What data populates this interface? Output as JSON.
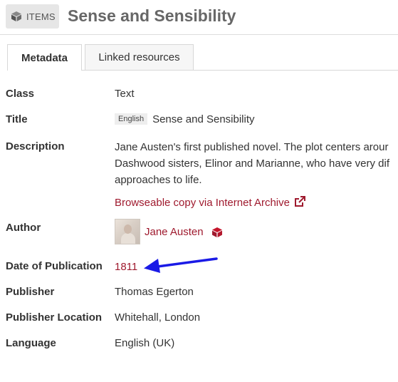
{
  "header": {
    "badge_label": "ITEMS",
    "title": "Sense and Sensibility"
  },
  "tabs": [
    {
      "label": "Metadata",
      "active": true
    },
    {
      "label": "Linked resources",
      "active": false
    }
  ],
  "metadata": {
    "class": {
      "label": "Class",
      "value": "Text"
    },
    "title": {
      "label": "Title",
      "lang": "English",
      "value": "Sense and Sensibility"
    },
    "description": {
      "label": "Description",
      "lines": [
        "Jane Austen's first published novel. The plot centers arour",
        "Dashwood sisters, Elinor and Marianne, who have very dif",
        "approaches to life."
      ],
      "link": "Browseable copy via Internet Archive"
    },
    "author": {
      "label": "Author",
      "value": "Jane Austen"
    },
    "date": {
      "label": "Date of Publication",
      "value": "1811"
    },
    "publisher": {
      "label": "Publisher",
      "value": "Thomas Egerton"
    },
    "publisher_location": {
      "label": "Publisher Location",
      "value": "Whitehall, London"
    },
    "language": {
      "label": "Language",
      "value": "English (UK)"
    }
  },
  "colors": {
    "link": "#9f1a2e",
    "arrow": "#1a1ae6"
  },
  "icons": [
    "cube-icon",
    "external-link-icon",
    "resource-cube-icon",
    "annotation-arrow"
  ]
}
